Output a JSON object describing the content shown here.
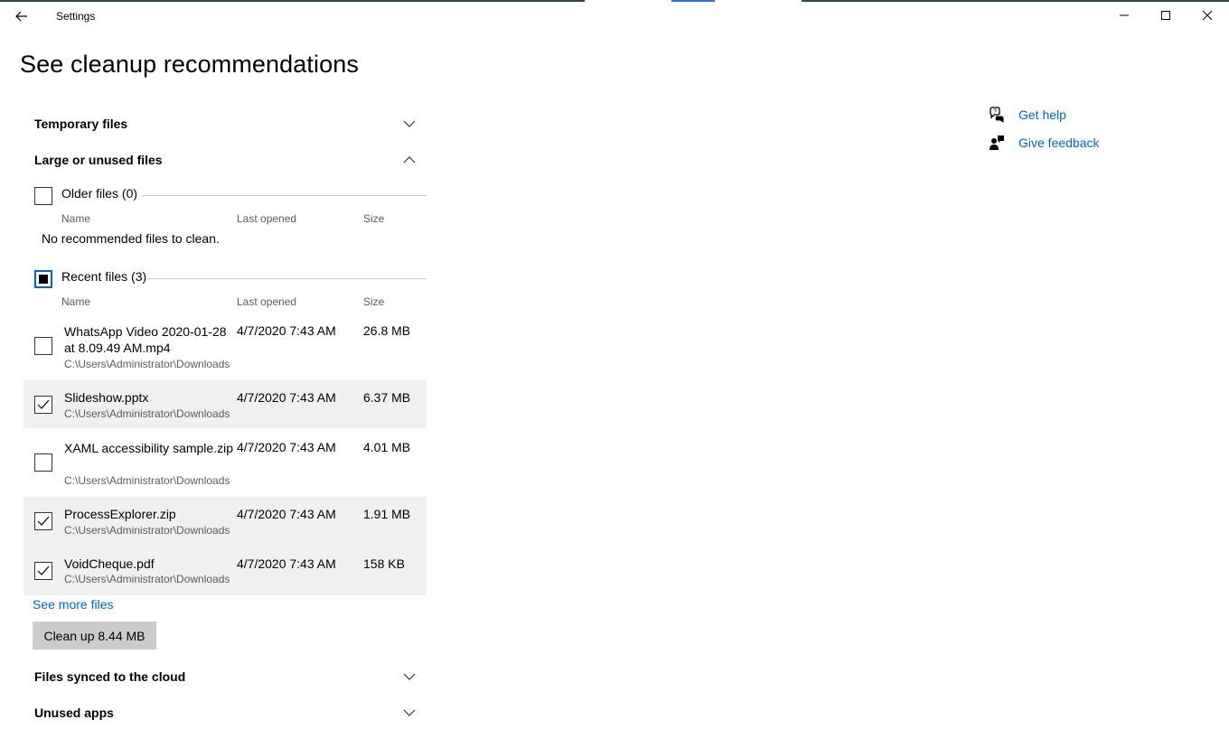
{
  "window": {
    "title": "Settings",
    "minimize": "minimize",
    "maximize": "maximize",
    "close": "close"
  },
  "page": {
    "title": "See cleanup recommendations"
  },
  "sections": {
    "temporary": {
      "label": "Temporary files",
      "expanded": false
    },
    "large": {
      "label": "Large or unused files",
      "expanded": true
    },
    "cloud": {
      "label": "Files synced to the cloud",
      "expanded": false
    },
    "apps": {
      "label": "Unused apps",
      "expanded": false
    }
  },
  "older": {
    "label": "Older files (0)",
    "checked": false,
    "col_name": "Name",
    "col_opened": "Last opened",
    "col_size": "Size",
    "empty": "No recommended files to clean."
  },
  "recent": {
    "label": "Recent files (3)",
    "state": "partial",
    "col_name": "Name",
    "col_opened": "Last opened",
    "col_size": "Size",
    "files": [
      {
        "name": "WhatsApp Video 2020-01-28 at 8.09.49 AM.mp4",
        "path": "C:\\Users\\Administrator\\Downloads",
        "opened": "4/7/2020 7:43 AM",
        "size": "26.8 MB",
        "checked": false
      },
      {
        "name": "Slideshow.pptx",
        "path": "C:\\Users\\Administrator\\Downloads",
        "opened": "4/7/2020 7:43 AM",
        "size": "6.37 MB",
        "checked": true
      },
      {
        "name": "XAML accessibility sample.zip",
        "path": "C:\\Users\\Administrator\\Downloads",
        "opened": "4/7/2020 7:43 AM",
        "size": "4.01 MB",
        "checked": false
      },
      {
        "name": "ProcessExplorer.zip",
        "path": "C:\\Users\\Administrator\\Downloads",
        "opened": "4/7/2020 7:43 AM",
        "size": "1.91 MB",
        "checked": true
      },
      {
        "name": "VoidCheque.pdf",
        "path": "C:\\Users\\Administrator\\Downloads",
        "opened": "4/7/2020 7:43 AM",
        "size": "158 KB",
        "checked": true
      }
    ]
  },
  "see_more": "See more files",
  "cleanup_button": "Clean up 8.44 MB",
  "help": {
    "get_help": "Get help",
    "give_feedback": "Give feedback"
  },
  "colors": {
    "accent": "#0067c0",
    "selected_row": "#f0f0f0",
    "button_bg": "#cccccc"
  }
}
